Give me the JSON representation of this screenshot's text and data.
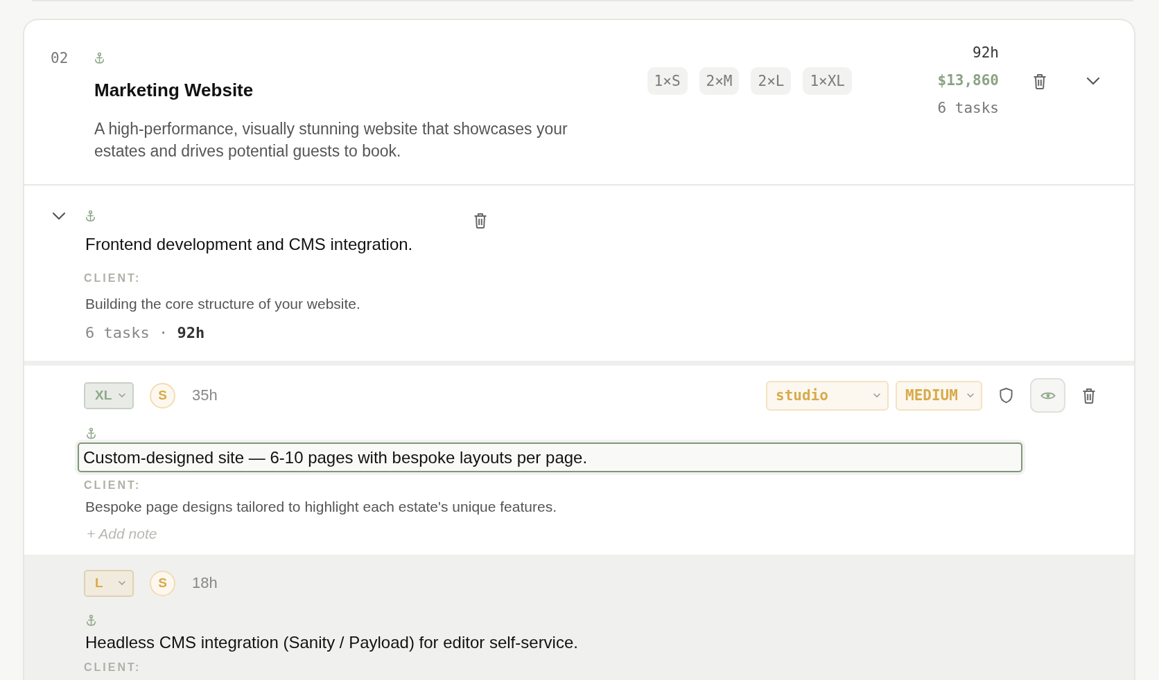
{
  "project": {
    "number": "02",
    "title": "Marketing Website",
    "description": "A high-performance, visually stunning website that showcases your estates and drives potential guests to book.",
    "size_tags": [
      "1×S",
      "2×M",
      "2×L",
      "1×XL"
    ],
    "hours": "92h",
    "price": "$13,860",
    "task_count": "6 tasks",
    "expanded": true
  },
  "deliverable": {
    "expanded": true,
    "title": "Frontend development and CMS integration.",
    "client_label": "CLIENT:",
    "client_note": "Building the core structure of your website.",
    "summary": "6 tasks · **92h**"
  },
  "tasks": [
    {
      "active": true,
      "size": {
        "label": "XL",
        "color": "#8fa88a"
      },
      "assignee": "S",
      "hours": "35h",
      "team": "studio",
      "priority": "MEDIUM",
      "visible": true,
      "editing": true,
      "title": "Custom-designed site — 6-10 pages with bespoke layouts per page.",
      "client_label": "CLIENT:",
      "client_note": "Bespoke page designs tailored to highlight each estate's unique features.",
      "add_note": "+ Add note"
    },
    {
      "active": false,
      "size": {
        "label": "L",
        "color": "#d9aa4a"
      },
      "assignee": "S",
      "hours": "18h",
      "editing": false,
      "title": "Headless CMS integration (Sanity / Payload) for editor self-service.",
      "client_label": "CLIENT:"
    }
  ]
}
